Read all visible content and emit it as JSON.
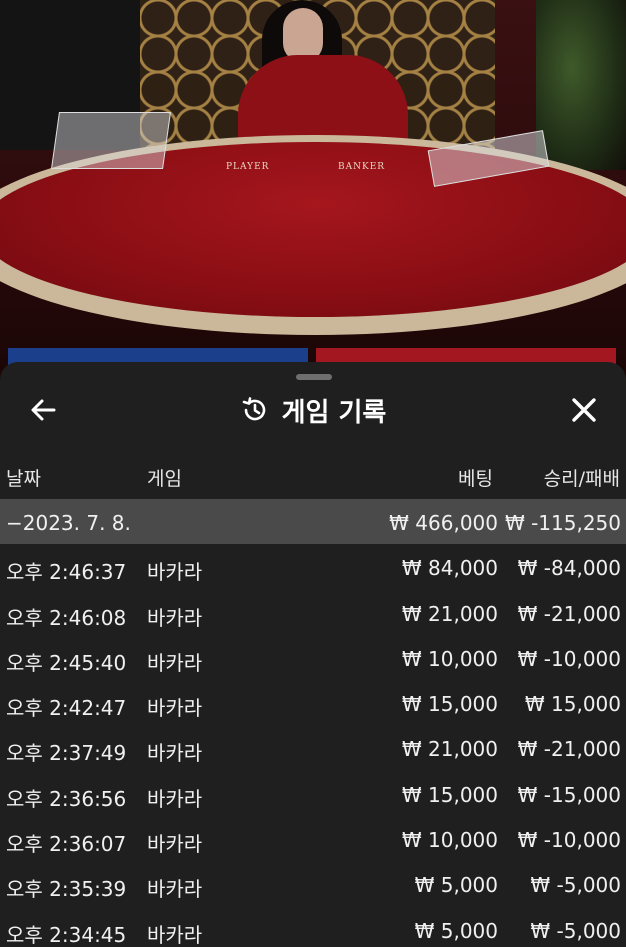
{
  "video": {
    "table_labels": {
      "player": "PLAYER",
      "banker": "BANKER"
    }
  },
  "panel": {
    "title": "게임 기록",
    "icons": {
      "back": "arrow-left-icon",
      "history": "history-icon",
      "close": "close-icon"
    },
    "columns": {
      "date": "날짜",
      "game": "게임",
      "bet": "베팅",
      "result": "승리/패배"
    },
    "summary": {
      "date": "−2023. 7. 8.",
      "bet": "₩ 466,000",
      "result": "₩ -115,250"
    },
    "rows": [
      {
        "time": "오후 2:46:37",
        "game": "바카라",
        "bet": "₩ 84,000",
        "result": "₩ -84,000"
      },
      {
        "time": "오후 2:46:08",
        "game": "바카라",
        "bet": "₩ 21,000",
        "result": "₩ -21,000"
      },
      {
        "time": "오후 2:45:40",
        "game": "바카라",
        "bet": "₩ 10,000",
        "result": "₩ -10,000"
      },
      {
        "time": "오후 2:42:47",
        "game": "바카라",
        "bet": "₩ 15,000",
        "result": "₩ 15,000"
      },
      {
        "time": "오후 2:37:49",
        "game": "바카라",
        "bet": "₩ 21,000",
        "result": "₩ -21,000"
      },
      {
        "time": "오후 2:36:56",
        "game": "바카라",
        "bet": "₩ 15,000",
        "result": "₩ -15,000"
      },
      {
        "time": "오후 2:36:07",
        "game": "바카라",
        "bet": "₩ 10,000",
        "result": "₩ -10,000"
      },
      {
        "time": "오후 2:35:39",
        "game": "바카라",
        "bet": "₩ 5,000",
        "result": "₩ -5,000"
      },
      {
        "time": "오후 2:34:45",
        "game": "바카라",
        "bet": "₩ 5,000",
        "result": "₩ -5,000"
      }
    ]
  },
  "colors": {
    "panel_bg": "#1f1f1f",
    "summary_bg": "#4a4a4a",
    "felt": "#8a0e14"
  }
}
